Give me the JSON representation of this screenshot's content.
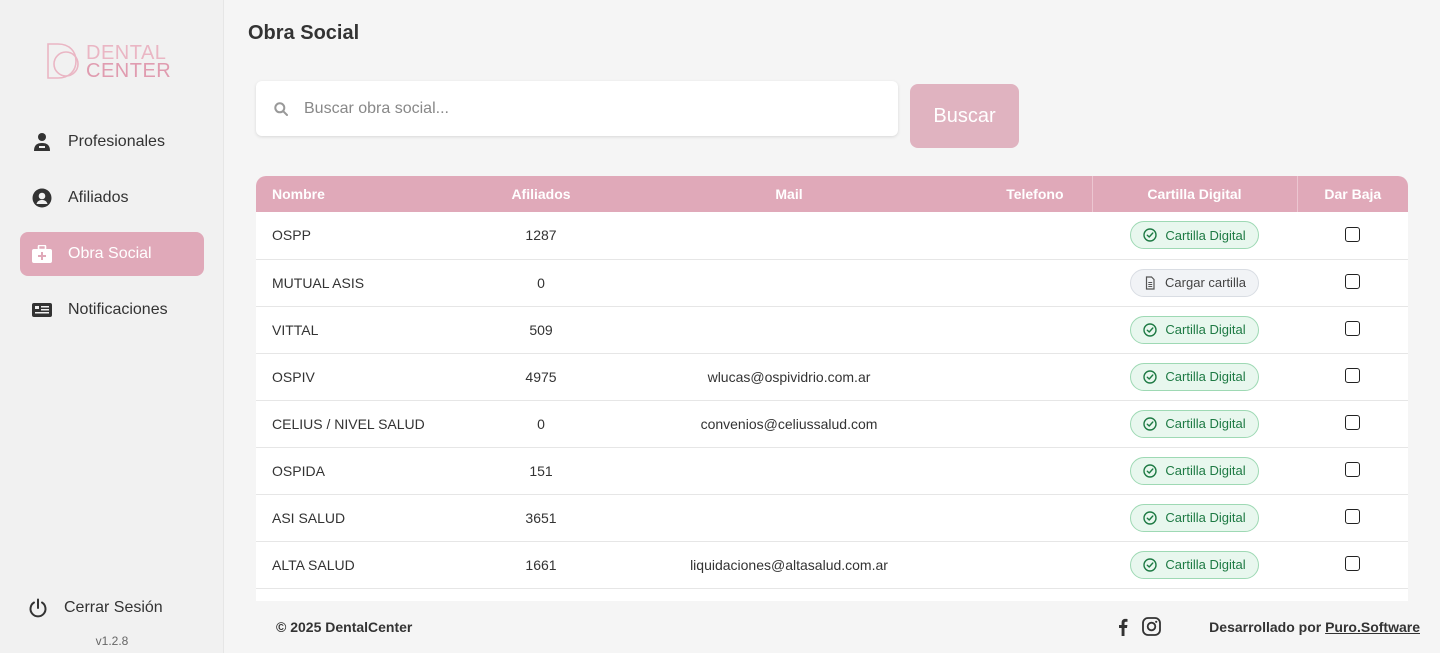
{
  "brand": {
    "logo_line1": "DENTAL",
    "logo_line2": "CENTER",
    "accent": "#e0a9b9"
  },
  "sidebar": {
    "items": [
      {
        "label": "Profesionales",
        "icon": "doctor-icon",
        "active": false
      },
      {
        "label": "Afiliados",
        "icon": "user-circle-icon",
        "active": false
      },
      {
        "label": "Obra Social",
        "icon": "medical-kit-icon",
        "active": true
      },
      {
        "label": "Notificaciones",
        "icon": "newspaper-icon",
        "active": false
      }
    ],
    "logout_label": "Cerrar Sesión",
    "version": "v1.2.8"
  },
  "page": {
    "title": "Obra Social"
  },
  "search": {
    "placeholder": "Buscar obra social...",
    "value": "",
    "button_label": "Buscar"
  },
  "table": {
    "headers": {
      "name": "Nombre",
      "afiliados": "Afiliados",
      "mail": "Mail",
      "telefono": "Telefono",
      "cartilla": "Cartilla Digital",
      "baja": "Dar Baja"
    },
    "rows": [
      {
        "name": "OSPP",
        "afiliados": "1287",
        "mail": "",
        "telefono": "",
        "cartilla": "Cartilla Digital",
        "cartilla_status": "ok",
        "baja": false
      },
      {
        "name": "MUTUAL ASIS",
        "afiliados": "0",
        "mail": "",
        "telefono": "",
        "cartilla": "Cargar cartilla",
        "cartilla_status": "load",
        "baja": false
      },
      {
        "name": "VITTAL",
        "afiliados": "509",
        "mail": "",
        "telefono": "",
        "cartilla": "Cartilla Digital",
        "cartilla_status": "ok",
        "baja": false
      },
      {
        "name": "OSPIV",
        "afiliados": "4975",
        "mail": "wlucas@ospividrio.com.ar",
        "telefono": "",
        "cartilla": "Cartilla Digital",
        "cartilla_status": "ok",
        "baja": false
      },
      {
        "name": "CELIUS / NIVEL SALUD",
        "afiliados": "0",
        "mail": "convenios@celiussalud.com",
        "telefono": "",
        "cartilla": "Cartilla Digital",
        "cartilla_status": "ok",
        "baja": false
      },
      {
        "name": "OSPIDA",
        "afiliados": "151",
        "mail": "",
        "telefono": "",
        "cartilla": "Cartilla Digital",
        "cartilla_status": "ok",
        "baja": false
      },
      {
        "name": "ASI SALUD",
        "afiliados": "3651",
        "mail": "",
        "telefono": "",
        "cartilla": "Cartilla Digital",
        "cartilla_status": "ok",
        "baja": false
      },
      {
        "name": "ALTA SALUD",
        "afiliados": "1661",
        "mail": "liquidaciones@altasalud.com.ar",
        "telefono": "",
        "cartilla": "Cartilla Digital",
        "cartilla_status": "ok",
        "baja": false
      }
    ]
  },
  "footer": {
    "copyright": "© 2025 DentalCenter",
    "dev_prefix": "Desarrollado por",
    "dev_link": "Puro.Software",
    "social": [
      "facebook-icon",
      "instagram-icon"
    ]
  }
}
